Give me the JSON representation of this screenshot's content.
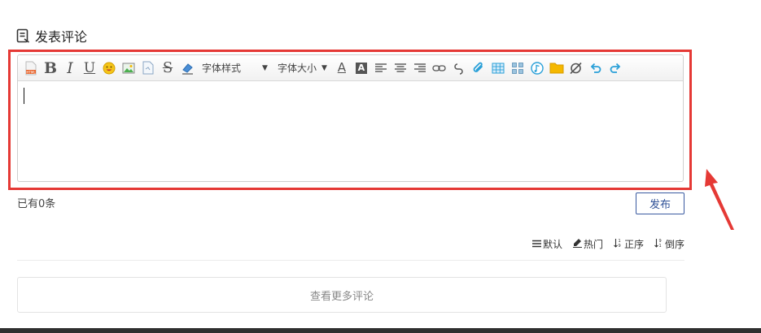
{
  "header": {
    "title": "发表评论"
  },
  "toolbar": {
    "font_style_label": "字体样式",
    "font_size_label": "字体大小",
    "dropdown_arrow": "▼",
    "bold": "B",
    "italic": "I",
    "underline": "U",
    "strike": "S",
    "font_color": "A",
    "bg_color": "A",
    "accent_color": "#2aa0d8",
    "icon_names": [
      "source-code-icon",
      "bold-icon",
      "italic-icon",
      "underline-icon",
      "emoji-icon",
      "image-icon",
      "file-icon",
      "strikethrough-icon",
      "eraser-icon",
      "font-color-icon",
      "background-color-icon",
      "align-left-icon",
      "align-center-icon",
      "align-right-icon",
      "link-icon",
      "unlink-icon",
      "attachment-icon",
      "table-icon",
      "gallery-icon",
      "music-icon",
      "folder-icon",
      "hide-icon",
      "undo-icon",
      "redo-icon"
    ]
  },
  "comments": {
    "count_text": "已有0条",
    "publish_label": "发布",
    "publish_color": "#2d4f96"
  },
  "sort": {
    "default_label": "默认",
    "hot_label": "热门",
    "asc_label": "正序",
    "desc_label": "倒序"
  },
  "more": {
    "label": "查看更多评论"
  },
  "annotation": {
    "highlight_color": "#e53935"
  }
}
